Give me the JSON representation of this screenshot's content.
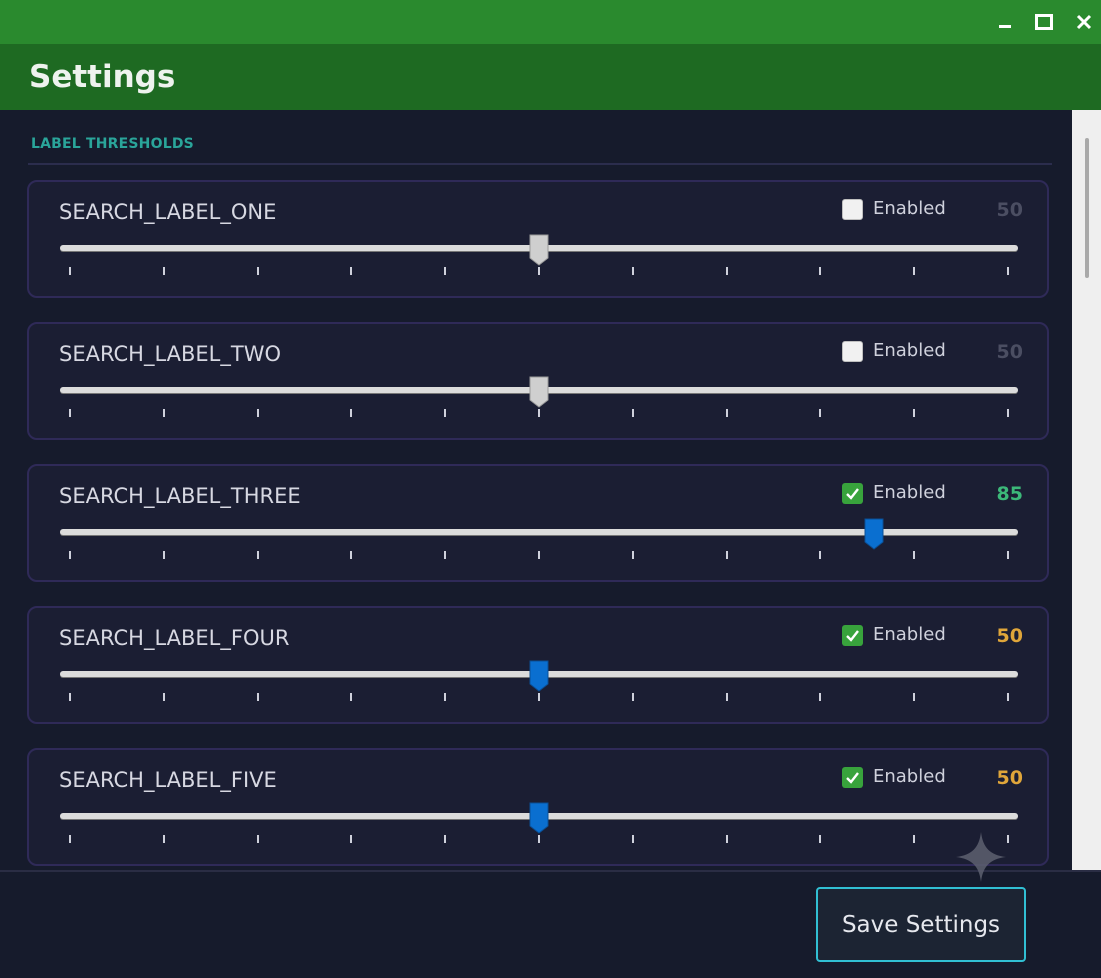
{
  "window": {
    "title": "Settings",
    "accent": "#2a8a2e"
  },
  "section": {
    "title": "LABEL THRESHOLDS"
  },
  "labels": [
    {
      "name": "SEARCH_LABEL_ONE",
      "enabled": false,
      "checkbox_label": "Enabled",
      "value": "50",
      "fraction": 0.5,
      "value_color": "#4b4e62"
    },
    {
      "name": "SEARCH_LABEL_TWO",
      "enabled": false,
      "checkbox_label": "Enabled",
      "value": "50",
      "fraction": 0.5,
      "value_color": "#4b4e62"
    },
    {
      "name": "SEARCH_LABEL_THREE",
      "enabled": true,
      "checkbox_label": "Enabled",
      "value": "85",
      "fraction": 0.85,
      "value_color": "#3cb879"
    },
    {
      "name": "SEARCH_LABEL_FOUR",
      "enabled": true,
      "checkbox_label": "Enabled",
      "value": "50",
      "fraction": 0.5,
      "value_color": "#e0a63a"
    },
    {
      "name": "SEARCH_LABEL_FIVE",
      "enabled": true,
      "checkbox_label": "Enabled",
      "value": "50",
      "fraction": 0.5,
      "value_color": "#e0a63a"
    }
  ],
  "footer": {
    "save_label": "Save Settings"
  },
  "colors": {
    "thumb_enabled": "#0a6fd0",
    "thumb_disabled": "#cfcfcf",
    "card_border": "#2f2a58"
  },
  "icons": [
    "minimize-icon",
    "maximize-icon",
    "close-icon",
    "checkmark-icon",
    "sparkle-icon"
  ]
}
